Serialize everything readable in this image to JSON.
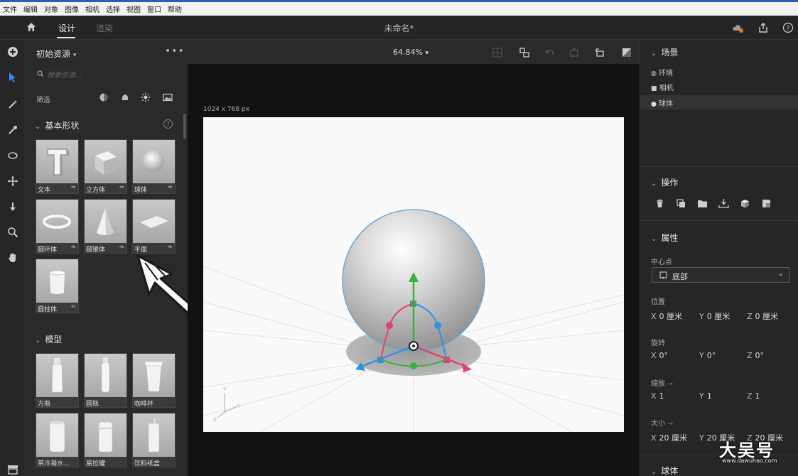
{
  "menu": [
    "文件",
    "编辑",
    "对象",
    "图像",
    "相机",
    "选择",
    "视图",
    "窗口",
    "帮助"
  ],
  "header": {
    "tab_design": "设计",
    "tab_render": "渲染",
    "doc_title": "未命名*"
  },
  "assets": {
    "title": "初始资源",
    "search_placeholder": "搜索资源...",
    "filter_label": "筛选",
    "basic_shapes": {
      "title": "基本形状",
      "items": [
        {
          "label": "文本",
          "icon": "text-3d-icon"
        },
        {
          "label": "立方体",
          "icon": "cube-icon"
        },
        {
          "label": "球体",
          "icon": "sphere-icon"
        },
        {
          "label": "圆环体",
          "icon": "torus-icon"
        },
        {
          "label": "圆锥体",
          "icon": "cone-icon"
        },
        {
          "label": "平面",
          "icon": "plane-icon"
        },
        {
          "label": "圆柱体",
          "icon": "cylinder-icon"
        }
      ]
    },
    "models": {
      "title": "模型",
      "items": [
        {
          "label": "方瓶",
          "icon": "bottle-icon"
        },
        {
          "label": "圆瓶",
          "icon": "round-bottle-icon"
        },
        {
          "label": "咖啡杯",
          "icon": "coffee-cup-icon"
        },
        {
          "label": "带冷凝水...",
          "icon": "can-condensation-icon"
        },
        {
          "label": "易拉罐",
          "icon": "soda-can-icon"
        },
        {
          "label": "饮料纸盒",
          "icon": "drink-carton-icon"
        }
      ]
    }
  },
  "toolbar": {
    "zoom": "64.84%"
  },
  "canvas": {
    "dimensions": "1024 x 768 px"
  },
  "scene": {
    "title": "场景",
    "items": [
      {
        "label": "环境",
        "icon": "environment-icon"
      },
      {
        "label": "相机",
        "icon": "camera-icon"
      },
      {
        "label": "球体",
        "icon": "sphere-object-icon"
      }
    ]
  },
  "actions": {
    "title": "操作"
  },
  "properties": {
    "title": "属性",
    "pivot_label": "中心点",
    "pivot_value": "底部",
    "position_label": "位置",
    "position": {
      "x": "0 厘米",
      "y": "0 厘米",
      "z": "0 厘米"
    },
    "rotation_label": "旋转",
    "rotation": {
      "x": "0°",
      "y": "0°",
      "z": "0°"
    },
    "scale_label": "缩放",
    "scale": {
      "x": "1",
      "y": "1",
      "z": "1"
    },
    "size_label": "大小",
    "size": {
      "x": "20 厘米",
      "y": "20 厘米",
      "z": "20 厘米"
    }
  },
  "bottom_section": {
    "title": "球体"
  },
  "axis_letters": {
    "x": "X",
    "y": "Y",
    "z": "Z"
  },
  "watermark": {
    "text": "大吴号",
    "url": "www.dawuhao.com"
  },
  "colors": {
    "gizmo_green": "#3fae3f",
    "gizmo_red": "#e0446e",
    "gizmo_blue": "#2f93e0",
    "accent_blue": "#2b5fb3"
  }
}
